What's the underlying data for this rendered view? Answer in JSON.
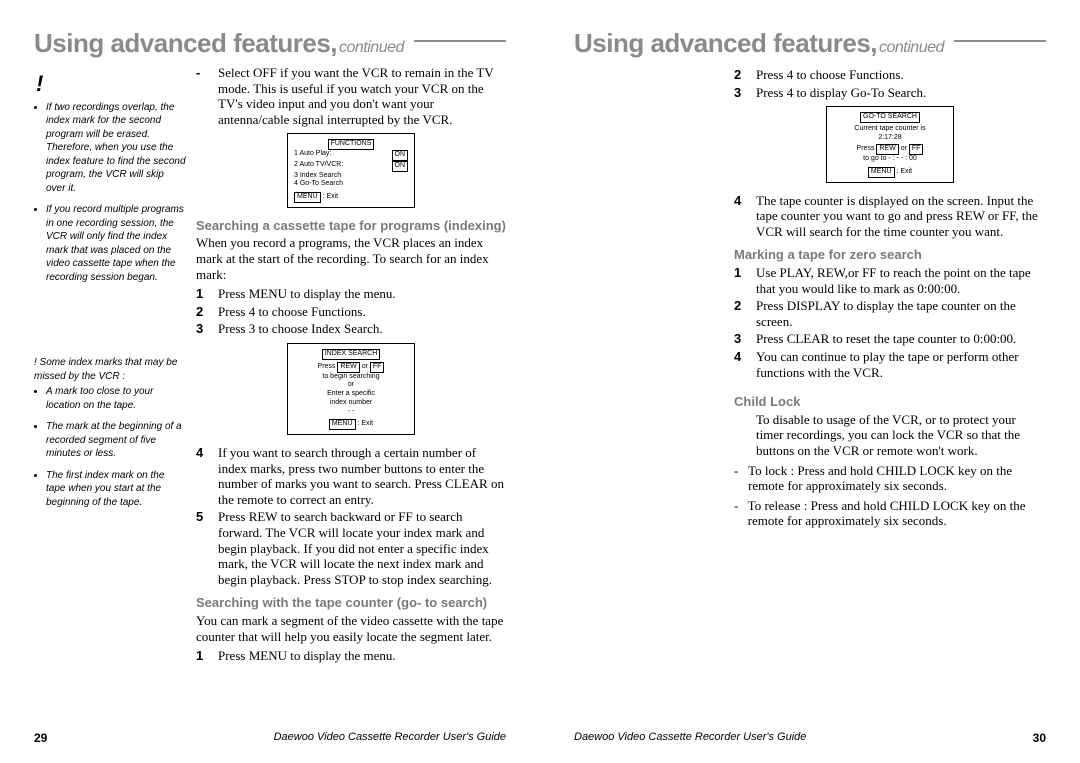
{
  "doc_title": "Daewoo Video Cassette Recorder User's Guide",
  "section_title_main": "Using advanced features,",
  "section_title_cont": "continued",
  "left_page": {
    "page_num": "29",
    "intro_bullet": "Select OFF if you want the VCR to remain in the TV mode. This is useful if you watch your VCR on the TV's video input and you don't want your antenna/cable signal interrupted by the VCR.",
    "osd1": {
      "title": "FUNCTIONS",
      "lines": [
        "1 Auto Play:",
        "2 Auto TV/VCR:",
        "3 Index Search",
        "4 Go-To Search"
      ],
      "states": [
        "ON",
        "ON"
      ],
      "footer": "MENU : Exit"
    },
    "side": {
      "bang": "!",
      "note1": "If two recordings overlap, the index mark for the second program will be erased. Therefore, when you use the index feature to find the second program, the VCR will skip over it.",
      "note2": "If you record multiple programs in one recording session, the VCR will only find the index mark that was placed on the video cassette tape when the recording session began.",
      "missed_intro": "! Some index marks that may be missed by the VCR :",
      "miss1": "A mark too close to your location on the tape.",
      "miss2": "The mark at the beginning of a recorded segment of five minutes or less.",
      "miss3": "The first index mark on the tape when you start at the beginning of the tape."
    },
    "h_index": "Searching a cassette tape for programs (indexing)",
    "p_index": "When you record a programs, the VCR places an index mark at the start of the recording. To search for an index mark:",
    "steps_index": [
      "Press MENU to display the menu.",
      "Press 4 to choose Functions.",
      "Press 3 to choose Index Search."
    ],
    "osd2": {
      "title": "INDEX SEARCH",
      "l1a": "Press",
      "l1_rew": "REW",
      "l1_or": "or",
      "l1_ff": "FF",
      "l2": "to begin searching",
      "l3": "or",
      "l4": "Enter a specific",
      "l5": "index number",
      "l6": "- -",
      "footer": "MENU : Exit"
    },
    "step4": "If you want to search through a certain number of index marks, press two number buttons to enter the number of marks you want to search. Press CLEAR on the remote to correct an entry.",
    "step5": "Press REW to search backward or FF to search forward. The VCR will locate your index mark and begin playback. If you did not enter a specific index mark, the VCR will locate the next index mark and begin playback. Press STOP to stop index searching.",
    "h_goto": "Searching with the tape counter (go- to search)",
    "p_goto": "You can mark a segment of the video cassette with the tape counter that will help you easily locate the segment later.",
    "goto_step1": "Press MENU to display the menu."
  },
  "right_page": {
    "page_num": "30",
    "steps_top": [
      "Press 4 to choose Functions.",
      "Press 4 to display Go-To Search."
    ],
    "osd3": {
      "title": "GO-TO SEARCH",
      "l1": "Current tape counter is",
      "l2": "2:17:28",
      "l3a": "Press",
      "l3_rew": "REW",
      "l3_or": "or",
      "l3_ff": "FF",
      "l4": "to go to  - : - - : 00",
      "footer": "MENU : Exit"
    },
    "step4": "The tape counter is displayed on the screen. Input the tape counter you want to go and press REW or FF, the VCR will search for the time counter you want.",
    "h_zero": "Marking a tape for zero search",
    "zero_steps": [
      "Use PLAY, REW,or FF to reach the point on the tape that you would like to mark as 0:00:00.",
      "Press DISPLAY to display the tape counter on the screen.",
      "Press CLEAR to reset the tape counter to 0:00:00.",
      "You can continue to play the tape or perform other functions with the VCR."
    ],
    "h_child": "Child Lock",
    "p_child": "To disable to usage of the VCR, or to protect your timer recordings, you can lock the VCR so that the buttons on the VCR or remote won't work.",
    "lock": "To lock : Press and hold CHILD LOCK key on the remote for approximately six seconds.",
    "unlock": "To release : Press and hold CHILD LOCK key on the remote for approximately six seconds."
  }
}
